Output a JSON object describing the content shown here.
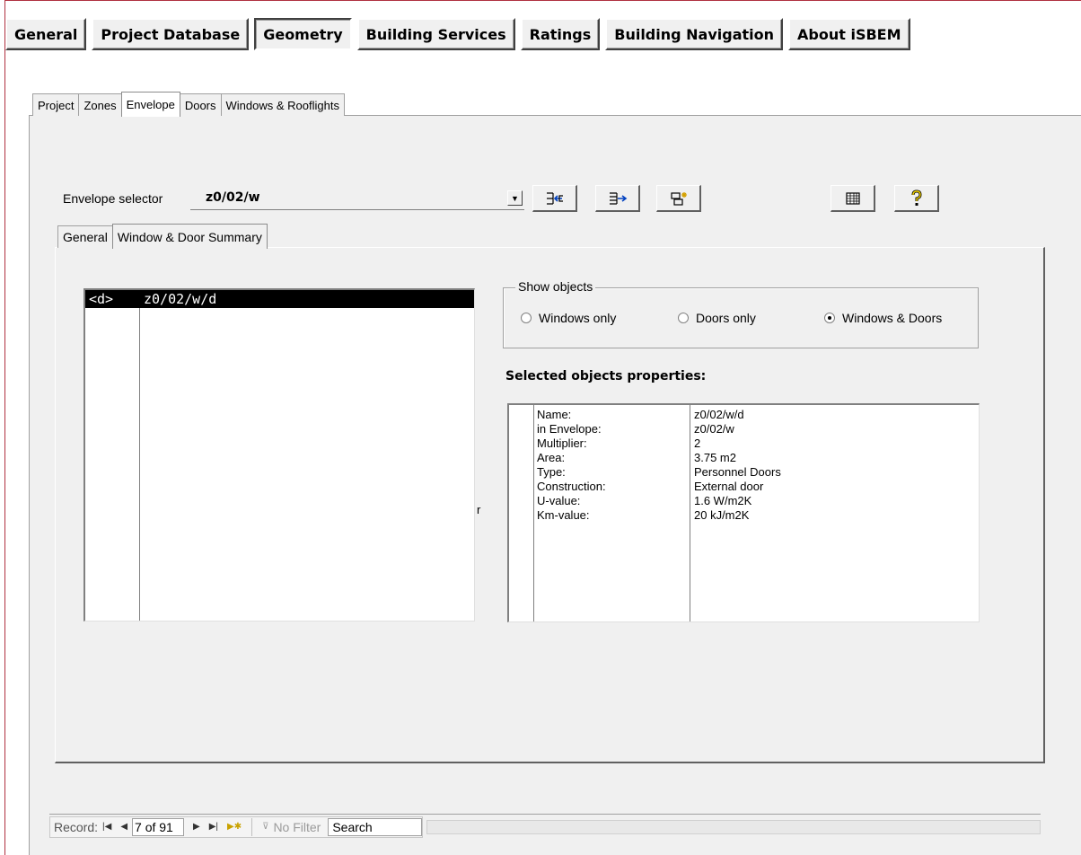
{
  "top_menu": [
    "General",
    "Project Database",
    "Geometry",
    "Building Services",
    "Ratings",
    "Building Navigation",
    "About iSBEM"
  ],
  "top_menu_active": "Geometry",
  "outer_tabs": [
    "Project",
    "Zones",
    "Envelope",
    "Doors",
    "Windows & Rooflights"
  ],
  "outer_tab_active": "Envelope",
  "envelope_selector": {
    "label": "Envelope selector",
    "value": "z0/02/w"
  },
  "toolbar_icons": [
    "move-left-icon",
    "move-right-icon",
    "new-record-icon",
    "table-icon",
    "help-icon"
  ],
  "inner_tabs": [
    "General",
    "Window & Door Summary"
  ],
  "inner_tab_active": "Window & Door Summary",
  "list": {
    "rows": [
      {
        "type": "<d>",
        "name": "z0/02/w/d"
      }
    ],
    "stray": "r"
  },
  "show_objects": {
    "title": "Show objects",
    "options": [
      "Windows only",
      "Doors only",
      "Windows & Doors"
    ],
    "selected": "Windows & Doors"
  },
  "selected_props": {
    "title": "Selected objects properties:",
    "rows": [
      {
        "key": "Name:",
        "value": "z0/02/w/d"
      },
      {
        "key": "in Envelope:",
        "value": "z0/02/w"
      },
      {
        "key": "Multiplier:",
        "value": "2"
      },
      {
        "key": "Area:",
        "value": "3.75 m2"
      },
      {
        "key": "Type:",
        "value": "Personnel Doors"
      },
      {
        "key": "Construction:",
        "value": "External door"
      },
      {
        "key": "U-value:",
        "value": "1.6  W/m2K"
      },
      {
        "key": "Km-value:",
        "value": "20  kJ/m2K"
      }
    ]
  },
  "record_nav": {
    "label": "Record:",
    "position": "7 of 91",
    "filter": "No Filter",
    "search": "Search"
  }
}
